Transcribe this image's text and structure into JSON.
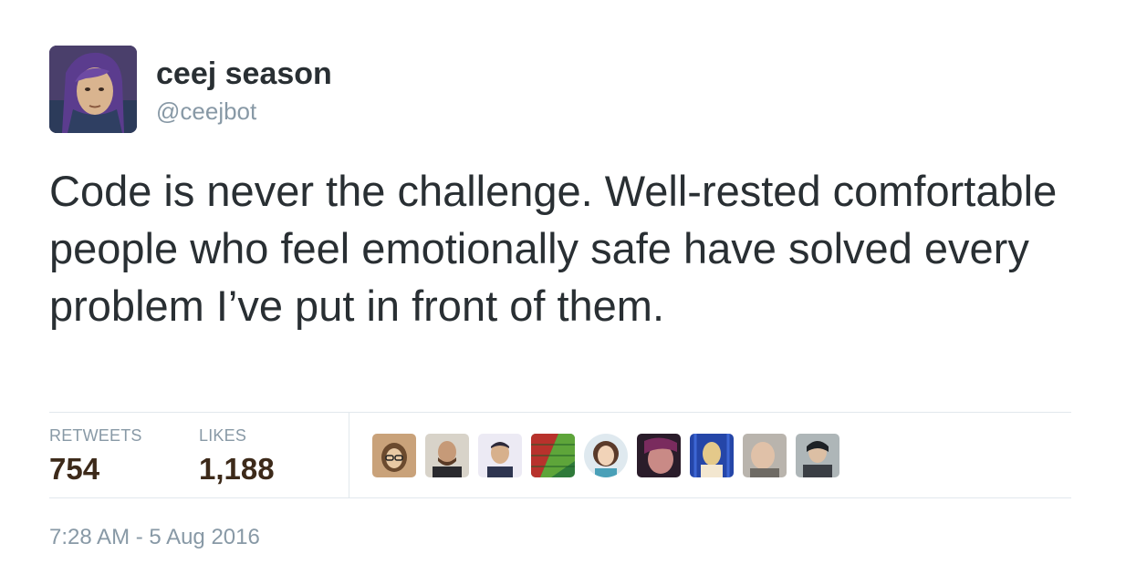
{
  "author": {
    "display_name": "ceej season",
    "handle": "@ceejbot"
  },
  "tweet": {
    "text": "Code is never the challenge. Well-rested comfortable people who feel emotionally safe have solved every problem I’ve put in front of them."
  },
  "stats": {
    "retweets_label": "RETWEETS",
    "retweets_count": "754",
    "likes_label": "LIKES",
    "likes_count": "1,188"
  },
  "timestamp": "7:28 AM - 5 Aug 2016",
  "colors": {
    "text": "#292f33",
    "muted": "#8899a6",
    "count": "#3d2a1a",
    "divider": "#e1e8ed"
  }
}
